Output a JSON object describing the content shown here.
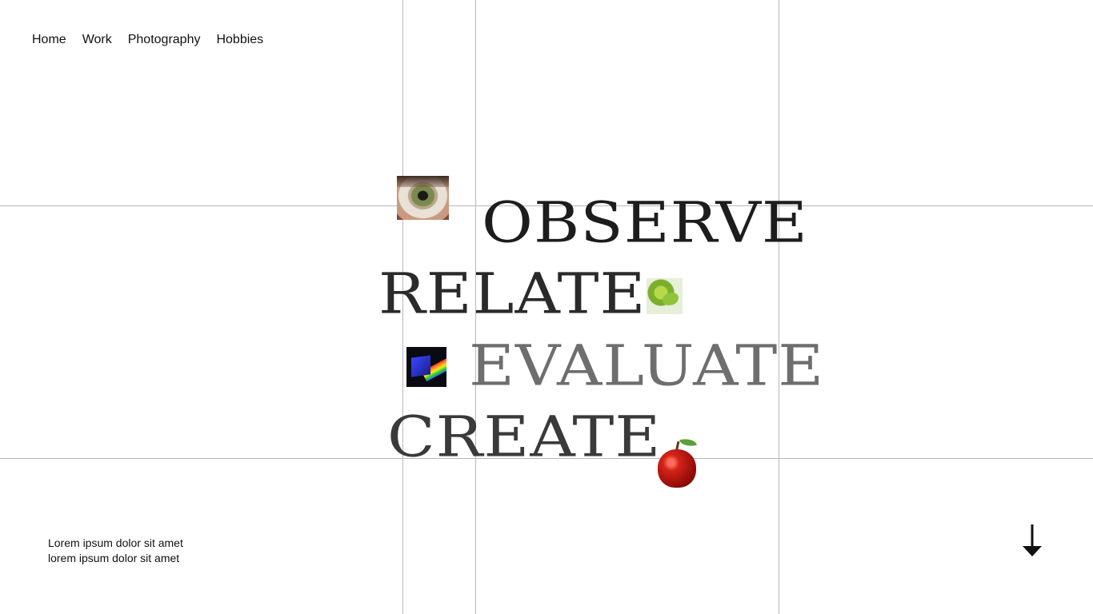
{
  "nav": {
    "items": [
      {
        "label": "Home"
      },
      {
        "label": "Work"
      },
      {
        "label": "Photography"
      },
      {
        "label": "Hobbies"
      }
    ]
  },
  "hero": {
    "words": {
      "observe": "OBSERVE",
      "relate": "RELATE",
      "evaluate": "EVALUATE",
      "create": "CREATE"
    },
    "images": {
      "observe": "eye-photo",
      "relate": "leaf-photo",
      "evaluate": "prism-photo",
      "create": "apple-photo"
    }
  },
  "footer": {
    "line1": "Lorem ipsum dolor sit amet",
    "line2": "lorem ipsum dolor sit amet"
  },
  "scroll": {
    "icon": "arrow-down-icon"
  },
  "colors": {
    "background": "#ffffff",
    "text": "#111111",
    "grid": "#b8b8b8"
  }
}
